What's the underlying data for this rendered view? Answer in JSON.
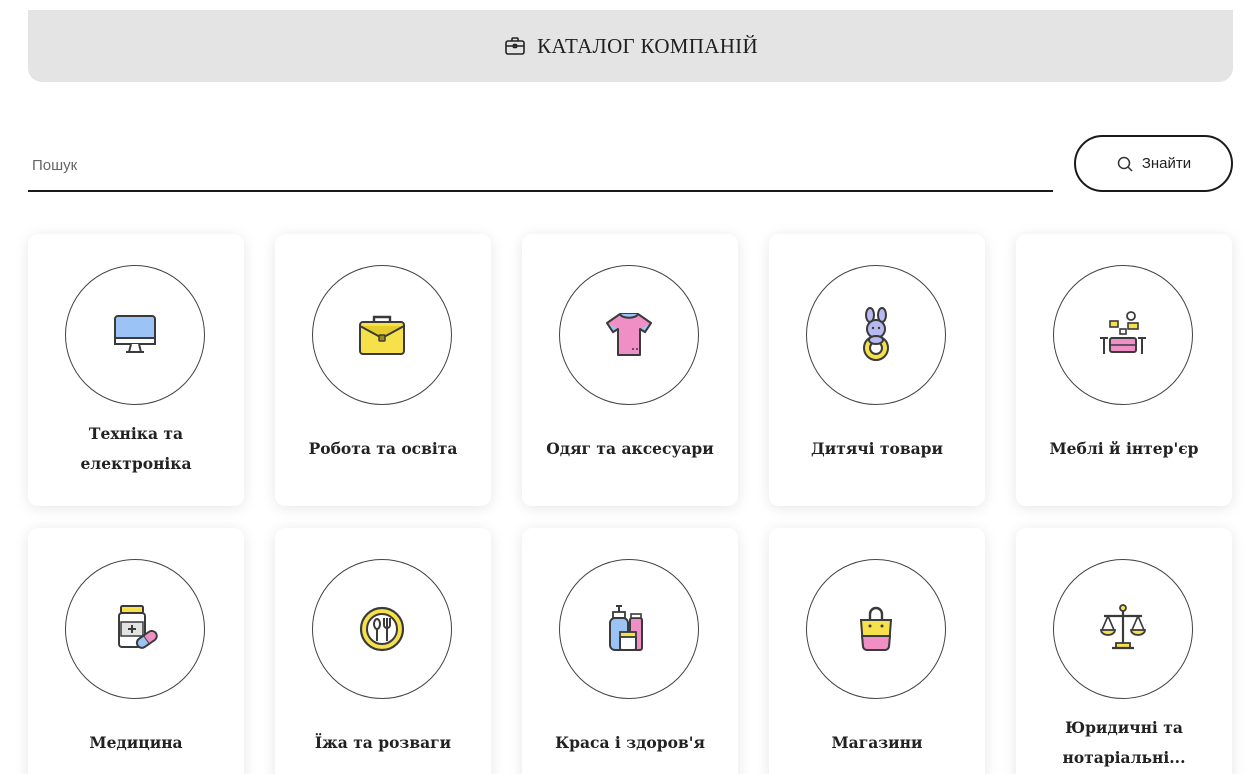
{
  "header": {
    "title": "КАТАЛОГ КОМПАНІЙ",
    "icon": "briefcase-icon"
  },
  "search": {
    "placeholder": "Пошук",
    "value": "",
    "button_label": "Знайти",
    "button_icon": "search-icon"
  },
  "categories": [
    {
      "label": "Техніка та електроніка",
      "icon": "monitor-icon"
    },
    {
      "label": "Робота та освіта",
      "icon": "briefcase-icon"
    },
    {
      "label": "Одяг та аксесуари",
      "icon": "tshirt-icon"
    },
    {
      "label": "Дитячі товари",
      "icon": "bunny-toy-icon"
    },
    {
      "label": "Меблі й інтер'єр",
      "icon": "sofa-interior-icon"
    },
    {
      "label": "Медицина",
      "icon": "medicine-pills-icon"
    },
    {
      "label": "Їжа та розваги",
      "icon": "plate-cutlery-icon"
    },
    {
      "label": "Краса і здоров'я",
      "icon": "cosmetics-icon"
    },
    {
      "label": "Магазини",
      "icon": "shopping-bag-icon"
    },
    {
      "label": "Юридичні та нотаріальні...",
      "icon": "scales-icon"
    }
  ],
  "colors": {
    "header_bg": "#e4e4e4",
    "icon_yellow": "#f6e14b",
    "icon_pink": "#ef8fc6",
    "icon_blue": "#9cc3f5",
    "icon_outline": "#3a3a3a"
  }
}
